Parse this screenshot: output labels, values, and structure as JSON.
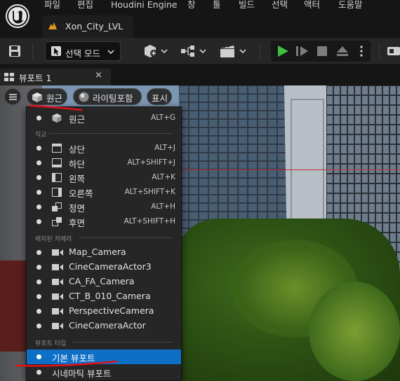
{
  "menubar": {
    "items": [
      "파일",
      "편집",
      "Houdini Engine",
      "창",
      "툴",
      "빌드",
      "선택",
      "액터",
      "도움말"
    ],
    "level_tab": "Xon_City_LVL"
  },
  "toolbar": {
    "mode_label": "선택 모드"
  },
  "viewport_tab": {
    "label": "뷰포트 1",
    "close": "×"
  },
  "viewport_toolbar": {
    "perspective_label": "원근",
    "lighting_label": "라이팅포함",
    "show_label": "표시"
  },
  "dropdown": {
    "perspective": {
      "label": "원근",
      "shortcut": "ALT+G"
    },
    "ortho_header": "직교",
    "ortho_items": [
      {
        "label": "상단",
        "shortcut": "ALT+J",
        "icon": "top-view-icon"
      },
      {
        "label": "하단",
        "shortcut": "ALT+SHIFT+J",
        "icon": "bottom-view-icon"
      },
      {
        "label": "왼쪽",
        "shortcut": "ALT+K",
        "icon": "left-view-icon"
      },
      {
        "label": "오른쪽",
        "shortcut": "ALT+SHIFT+K",
        "icon": "right-view-icon"
      },
      {
        "label": "정면",
        "shortcut": "ALT+H",
        "icon": "front-view-icon"
      },
      {
        "label": "후면",
        "shortcut": "ALT+SHIFT+H",
        "icon": "back-view-icon"
      }
    ],
    "camera_header": "배치된 카메라",
    "cameras": [
      "Map_Camera",
      "CineCameraActor3",
      "CA_FA_Camera",
      "CT_B_010_Camera",
      "PerspectiveCamera",
      "CineCameraActor"
    ],
    "viewport_type_header": "뷰포트 타입",
    "viewport_types": [
      {
        "label": "기본 뷰포트",
        "selected": true
      },
      {
        "label": "시네마틱 뷰포트",
        "selected": false
      }
    ]
  },
  "colors": {
    "selection": "#0e6fc7",
    "annotation": "#e0101a",
    "play": "#3fbf3f"
  }
}
